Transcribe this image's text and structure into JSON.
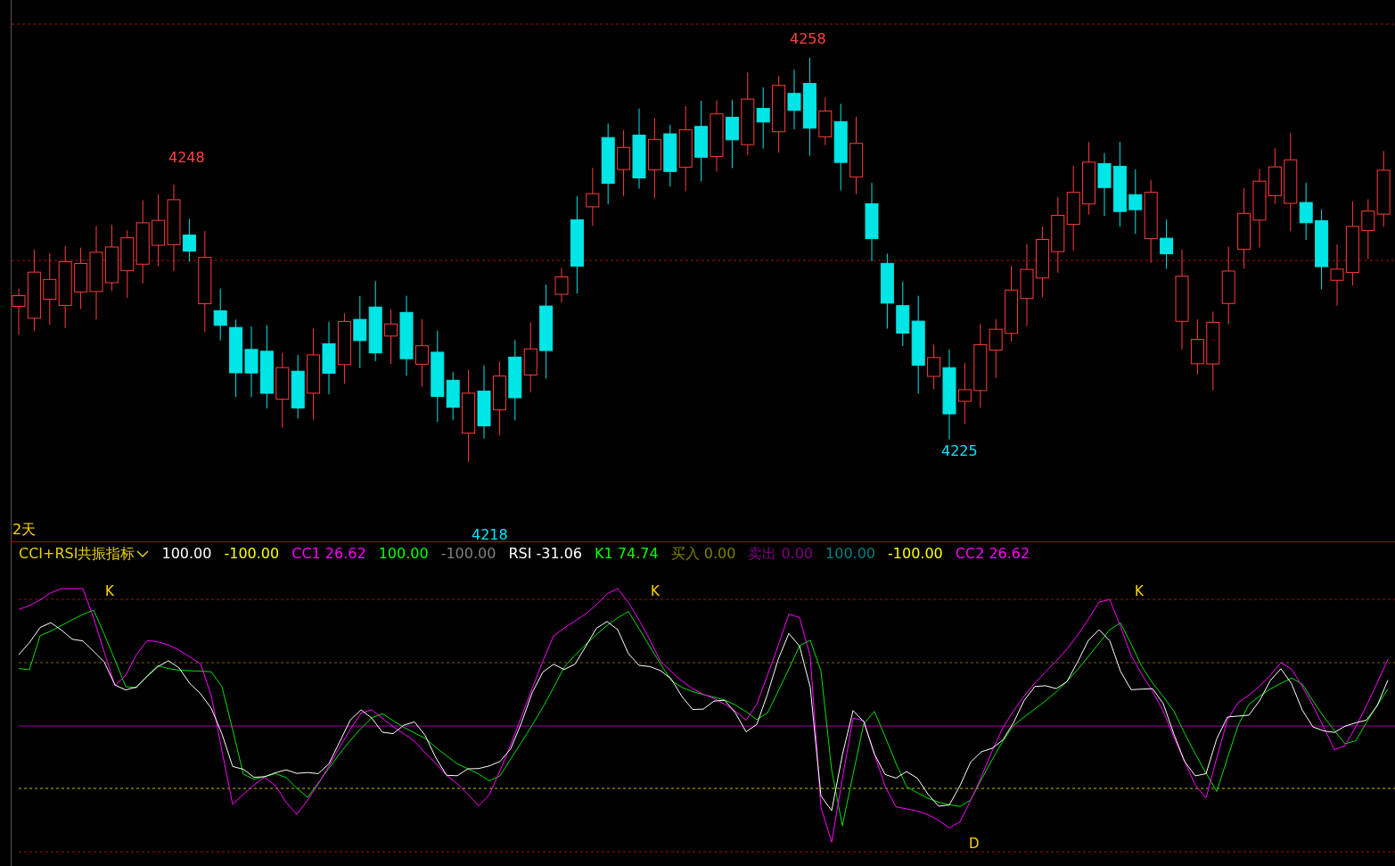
{
  "price_chart": {
    "period_label": "2天",
    "price_labels": [
      {
        "text": "4248",
        "kind": "high"
      },
      {
        "text": "4258",
        "kind": "high"
      },
      {
        "text": "4218",
        "kind": "low"
      },
      {
        "text": "4225",
        "kind": "low"
      }
    ]
  },
  "indicator": {
    "name": "CCI+RSI共振指标",
    "legend": [
      {
        "value": "100.00",
        "color": "#ffffff"
      },
      {
        "value": "-100.00",
        "color": "#ffff00"
      },
      {
        "name": "CC1",
        "value": "26.62",
        "color": "#ff00ff"
      },
      {
        "value": "100.00",
        "color": "#00ff00"
      },
      {
        "value": "-100.00",
        "color": "#808080"
      },
      {
        "name": "RSI",
        "value": "-31.06",
        "color": "#ffffff"
      },
      {
        "name": "K1",
        "value": "74.74",
        "color": "#00ff00"
      },
      {
        "name": "买入",
        "value": "0.00",
        "color": "#808000"
      },
      {
        "name": "卖出",
        "value": "0.00",
        "color": "#800080"
      },
      {
        "value": "100.00",
        "color": "#008080"
      },
      {
        "value": "-100.00",
        "color": "#ffff00"
      },
      {
        "name": "CC2",
        "value": "26.62",
        "color": "#ff00ff"
      }
    ],
    "signals": [
      {
        "text": "K"
      },
      {
        "text": "K"
      },
      {
        "text": "K"
      },
      {
        "text": "D"
      }
    ]
  }
}
